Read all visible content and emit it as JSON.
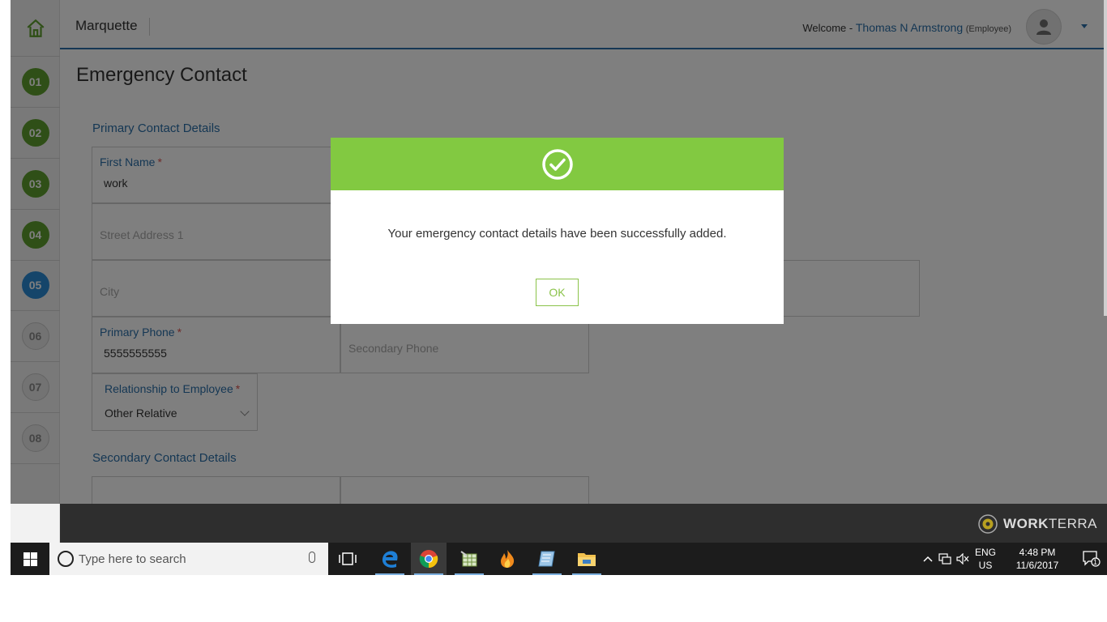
{
  "header": {
    "company": "Marquette",
    "welcome_prefix": "Welcome -",
    "user_name": "Thomas N Armstrong",
    "user_role": "(Employee)"
  },
  "steps": [
    {
      "label": "01",
      "state": "done"
    },
    {
      "label": "02",
      "state": "done"
    },
    {
      "label": "03",
      "state": "done"
    },
    {
      "label": "04",
      "state": "done"
    },
    {
      "label": "05",
      "state": "current"
    },
    {
      "label": "06",
      "state": "todo"
    },
    {
      "label": "07",
      "state": "todo"
    },
    {
      "label": "08",
      "state": "todo"
    }
  ],
  "page": {
    "title": "Emergency Contact",
    "primary_section": "Primary Contact Details",
    "secondary_section": "Secondary Contact Details"
  },
  "form": {
    "first_name_label": "First Name",
    "first_name_value": "work",
    "street_address_placeholder": "Street Address 1",
    "city_placeholder": "City",
    "primary_phone_label": "Primary Phone",
    "primary_phone_value": "5555555555",
    "secondary_phone_placeholder": "Secondary Phone",
    "relationship_label": "Relationship to Employee",
    "relationship_value": "Other Relative",
    "required_mark": "*"
  },
  "modal": {
    "message": "Your emergency contact details have been successfully added.",
    "ok_label": "OK"
  },
  "footer": {
    "brand_bold": "WORK",
    "brand_thin": "TERRA"
  },
  "taskbar": {
    "search_placeholder": "Type here to search",
    "lang_top": "ENG",
    "lang_bottom": "US",
    "time": "4:48 PM",
    "date": "11/6/2017",
    "notification_count": "1"
  },
  "colors": {
    "accent_blue": "#2a6fa8",
    "step_done": "#5f9f2e",
    "step_current": "#2a8ad4",
    "modal_banner": "#82c941",
    "ok_border": "#8bc34a"
  }
}
